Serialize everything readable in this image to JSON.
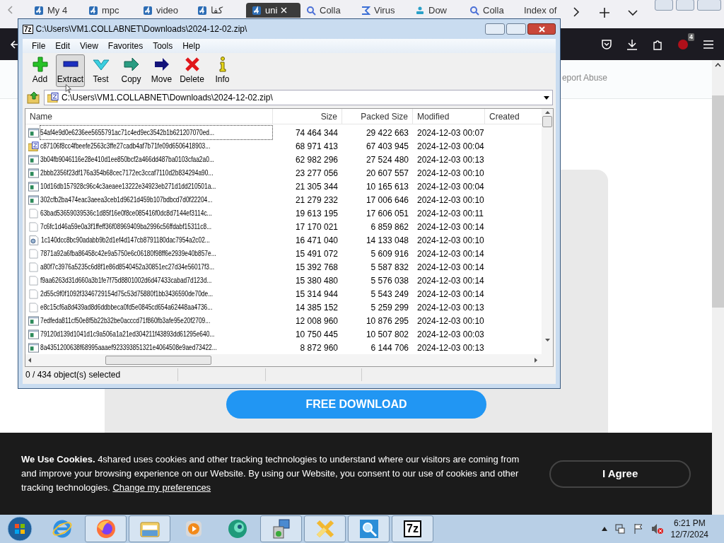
{
  "browser": {
    "tabs": [
      {
        "label": "My 4",
        "kind": "site",
        "selected": false
      },
      {
        "label": "mpc",
        "kind": "site",
        "selected": false
      },
      {
        "label": "video",
        "kind": "site",
        "selected": false
      },
      {
        "label": "كفا",
        "kind": "site",
        "selected": false
      },
      {
        "label": "uni",
        "kind": "site",
        "selected": true
      },
      {
        "label": "Colla",
        "kind": "search",
        "selected": false
      },
      {
        "label": "Virus",
        "kind": "virus",
        "selected": false
      },
      {
        "label": "Dow",
        "kind": "download",
        "selected": false
      },
      {
        "label": "Colla",
        "kind": "search",
        "selected": false
      },
      {
        "label": "Index of",
        "kind": "none",
        "selected": false
      }
    ],
    "extension_badge": "4"
  },
  "page": {
    "header_link": "eport Abuse",
    "download_button": "FREE DOWNLOAD"
  },
  "cookie_banner": {
    "text": "**We Use Cookies.** 4shared uses cookies and other tracking technologies to understand where our visitors are coming from and improve your browsing experience on our Website. By using our Website, you consent to our use of cookies and other tracking technologies.",
    "link": "Change my preferences",
    "button": "I Agree"
  },
  "archiver": {
    "icon_text": "7z",
    "title": "C:\\Users\\VM1.COLLABNET\\Downloads\\2024-12-02.zip\\",
    "menu": [
      "File",
      "Edit",
      "View",
      "Favorites",
      "Tools",
      "Help"
    ],
    "toolbar": [
      {
        "label": "Add",
        "kind": "add",
        "selected": false
      },
      {
        "label": "Extract",
        "kind": "extract",
        "selected": true
      },
      {
        "label": "Test",
        "kind": "test",
        "selected": false
      },
      {
        "label": "Copy",
        "kind": "copy",
        "selected": false
      },
      {
        "label": "Move",
        "kind": "move",
        "selected": false
      },
      {
        "label": "Delete",
        "kind": "delete",
        "selected": false
      },
      {
        "label": "Info",
        "kind": "info",
        "selected": false
      }
    ],
    "path": "C:\\Users\\VM1.COLLABNET\\Downloads\\2024-12-02.zip\\",
    "columns": [
      "Name",
      "Size",
      "Packed Size",
      "Modified",
      "Created"
    ],
    "rows": [
      {
        "name": "54af4e9d0e6236ee5655791ac71c4ed9ec3542b1b621207070ed...",
        "size": "74 464 344",
        "packed": "29 422 663",
        "modified": "2024-12-03 00:07",
        "kind": "exe",
        "focused": true
      },
      {
        "name": "c87106f8cc4fbeefe2563c3ffe27cadb4af7b71fe09d6506418903...",
        "size": "68 971 413",
        "packed": "67 403 945",
        "modified": "2024-12-03 00:04",
        "kind": "zip",
        "focused": false
      },
      {
        "name": "3b04fb9046116e28e410d1ee850bcf2a466dd487ba0103cfaa2a0...",
        "size": "62 982 296",
        "packed": "27 524 480",
        "modified": "2024-12-03 00:13",
        "kind": "exe",
        "focused": false
      },
      {
        "name": "2bbb2356f23df176a354b68cec7172ec3ccaf7110d2b834294a90...",
        "size": "23 277 056",
        "packed": "20 607 557",
        "modified": "2024-12-03 00:10",
        "kind": "exe",
        "focused": false
      },
      {
        "name": "10d16db157928c96c4c3aeaee13222e34923eb271d1dd210501a...",
        "size": "21 305 344",
        "packed": "10 165 613",
        "modified": "2024-12-03 00:04",
        "kind": "exe",
        "focused": false
      },
      {
        "name": "302cfb2ba474eac3aeea3ceb1d9621d459b107bdbcd7d0f22204...",
        "size": "21 279 232",
        "packed": "17 006 646",
        "modified": "2024-12-03 00:10",
        "kind": "exe",
        "focused": false
      },
      {
        "name": "63bad53659039536c1d85f16e0f8ce085416f0dc8d7144ef3114c...",
        "size": "19 613 195",
        "packed": "17 606 051",
        "modified": "2024-12-03 00:11",
        "kind": "file",
        "focused": false
      },
      {
        "name": "7c6fc1d46a59e0a3f1ffeff36f08969409ba2996c56ffdabf15311c8...",
        "size": "17 170 021",
        "packed": "6 859 862",
        "modified": "2024-12-03 00:14",
        "kind": "file",
        "focused": false
      },
      {
        "name": "1c140dcc8bc90adabb9b2d1ef4d147cb8791180dac7954a2c02...",
        "size": "16 471 040",
        "packed": "14 133 048",
        "modified": "2024-12-03 00:10",
        "kind": "dll",
        "focused": false
      },
      {
        "name": "7871a92a6fba86458c42e9a5750e6c06180f98ff6e2939e40b857e...",
        "size": "15 491 072",
        "packed": "5 609 916",
        "modified": "2024-12-03 00:14",
        "kind": "file",
        "focused": false
      },
      {
        "name": "a80f7c3976a5235c6d8f1e86d8540452a30851ec27d34e56017f3...",
        "size": "15 392 768",
        "packed": "5 587 832",
        "modified": "2024-12-03 00:14",
        "kind": "file",
        "focused": false
      },
      {
        "name": "f9aa6263d31d660a3b1fe7f75d8801002d6d47433cabad7d123d...",
        "size": "15 380 480",
        "packed": "5 576 038",
        "modified": "2024-12-03 00:14",
        "kind": "file",
        "focused": false
      },
      {
        "name": "2d55c9f0f1092f3346729154d75c53d75880f1bb3436590de70de...",
        "size": "15 314 944",
        "packed": "5 543 249",
        "modified": "2024-12-03 00:14",
        "kind": "file",
        "focused": false
      },
      {
        "name": "e8c15cf6a8d439ad8d6ddbbeca0fd5e0845cd654a62448aa4736...",
        "size": "14 385 152",
        "packed": "5 259 299",
        "modified": "2024-12-03 00:13",
        "kind": "file",
        "focused": false
      },
      {
        "name": "7edfeda811cf50e8f5b22b32be0acccd71f860fb3afe95e20f2709...",
        "size": "12 008 960",
        "packed": "10 876 295",
        "modified": "2024-12-03 00:10",
        "kind": "exe",
        "focused": false
      },
      {
        "name": "79120d139d1041d1c9a506a1a21ed304211f43893dd61295e640...",
        "size": "10 750 445",
        "packed": "10 507 802",
        "modified": "2024-12-03 00:03",
        "kind": "exe",
        "focused": false
      },
      {
        "name": "8a4351200638f68995aaaef923393851321e4064508e9aed73422...",
        "size": "8 872 960",
        "packed": "6 144 706",
        "modified": "2024-12-03 00:13",
        "kind": "exe",
        "focused": false
      }
    ],
    "status": "0 / 434 object(s) selected"
  },
  "taskbar": {
    "apps": [
      {
        "kind": "ie",
        "running": false
      },
      {
        "kind": "firefox",
        "running": true
      },
      {
        "kind": "explorer",
        "running": true
      },
      {
        "kind": "media",
        "running": false
      },
      {
        "kind": "globe",
        "running": false
      },
      {
        "kind": "setup",
        "running": true
      },
      {
        "kind": "tool",
        "running": true
      },
      {
        "kind": "search",
        "running": true
      },
      {
        "kind": "sevenzip",
        "running": true,
        "text": "7z"
      }
    ],
    "time": "6:21 PM",
    "date": "12/7/2024"
  }
}
